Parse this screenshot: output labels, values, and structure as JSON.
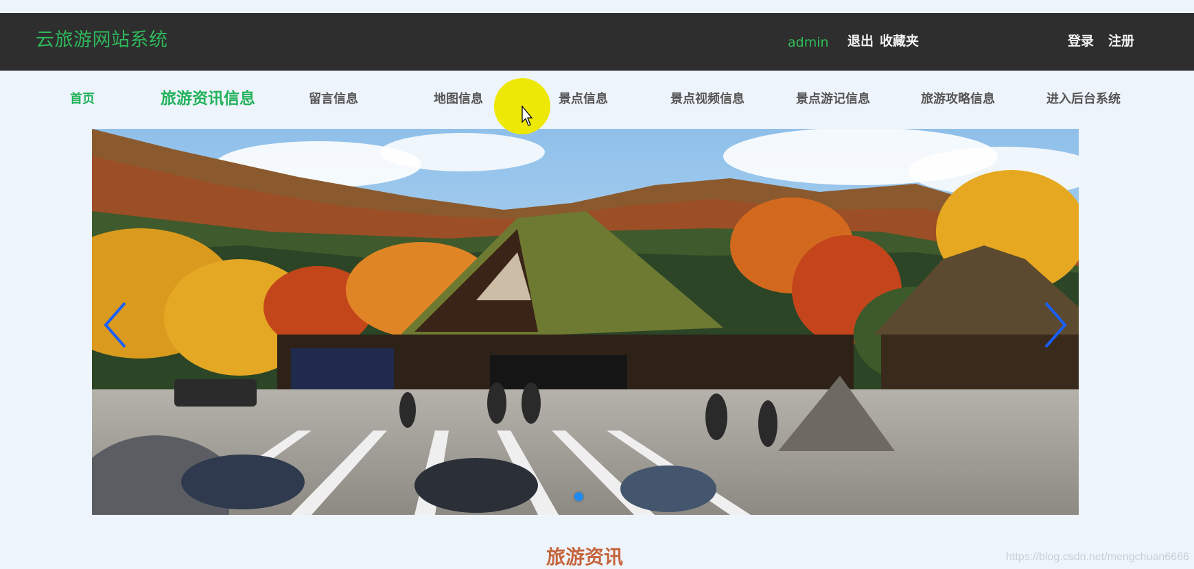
{
  "header": {
    "site_title": "云旅游网站系统",
    "user_name": "admin",
    "logout_label": "退出",
    "favorites_label": "收藏夹",
    "login_label": "登录",
    "register_label": "注册",
    "background_color": "#2e2e2e",
    "title_color": "#2eb85c"
  },
  "nav": {
    "items": [
      {
        "label": "首页",
        "state": "active"
      },
      {
        "label": "旅游资讯信息",
        "state": "current"
      },
      {
        "label": "留言信息"
      },
      {
        "label": "地图信息"
      },
      {
        "label": "景点信息"
      },
      {
        "label": "景点视频信息"
      },
      {
        "label": "景点游记信息"
      },
      {
        "label": "旅游攻略信息"
      },
      {
        "label": "进入后台系统"
      }
    ],
    "active_color": "#20b15a"
  },
  "banner": {
    "prev_icon": "chevron-left-icon",
    "next_icon": "chevron-right-icon",
    "indicator_count": 1,
    "active_indicator": 1,
    "arrow_color": "#1a5fff"
  },
  "section": {
    "title": "旅游资讯",
    "title_color": "#c5643b"
  },
  "watermark": {
    "text": "https://blog.csdn.net/mengchuan6666"
  }
}
